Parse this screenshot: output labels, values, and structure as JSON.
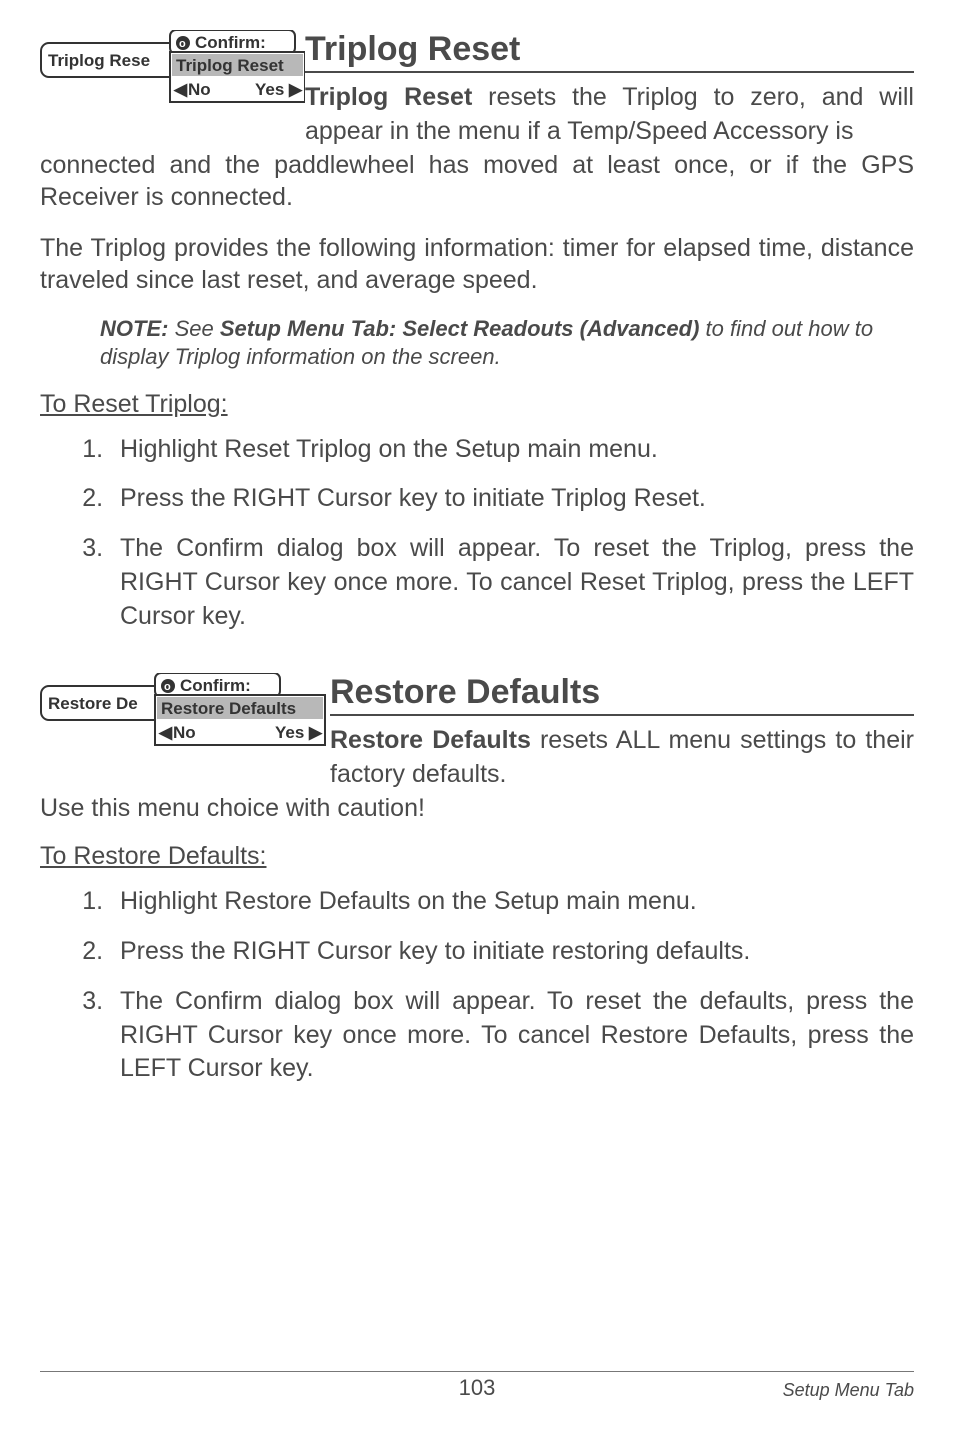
{
  "section1": {
    "title": "Triplog Reset",
    "graphic": {
      "back_label": "Triplog Rese",
      "confirm_header": "Confirm:",
      "dialog_label": "Triplog Reset",
      "no": "No",
      "yes": "Yes"
    },
    "intro_bold": "Triplog Reset",
    "intro_rest": " resets the Triplog to zero, and will appear in the menu if a Temp/Speed Accessory is",
    "cont": "connected and the paddlewheel has moved at least once, or if the GPS Receiver is connected.",
    "para2": "The Triplog provides the following information: timer for elapsed time, distance traveled since last reset, and average speed.",
    "note_label": "NOTE:",
    "note_text1": " See ",
    "note_bold": "Setup Menu Tab: Select Readouts (Advanced)",
    "note_text2": " to find out how to display Triplog information on the screen.",
    "subhead": "To Reset Triplog:",
    "steps": [
      "Highlight Reset Triplog on the Setup main menu.",
      "Press the RIGHT Cursor key to initiate Triplog Reset.",
      "The Confirm dialog box will appear. To reset the Triplog, press the RIGHT Cursor key once more. To cancel Reset Triplog, press the LEFT Cursor key."
    ]
  },
  "section2": {
    "title": "Restore Defaults",
    "graphic": {
      "back_label": "Restore De",
      "confirm_header": "Confirm:",
      "dialog_label": "Restore Defaults",
      "no": "No",
      "yes": "Yes"
    },
    "intro_bold": "Restore Defaults",
    "intro_rest": " resets ALL menu settings to their factory defaults.",
    "para2": "Use this menu choice with caution!",
    "subhead": "To Restore Defaults:",
    "steps": [
      "Highlight Restore Defaults on the Setup main menu.",
      "Press the RIGHT Cursor key to initiate restoring defaults.",
      "The Confirm dialog box will appear. To reset the defaults, press the RIGHT Cursor key once more. To cancel Restore Defaults, press the LEFT Cursor key."
    ]
  },
  "footer": {
    "page": "103",
    "label": "Setup Menu Tab"
  }
}
